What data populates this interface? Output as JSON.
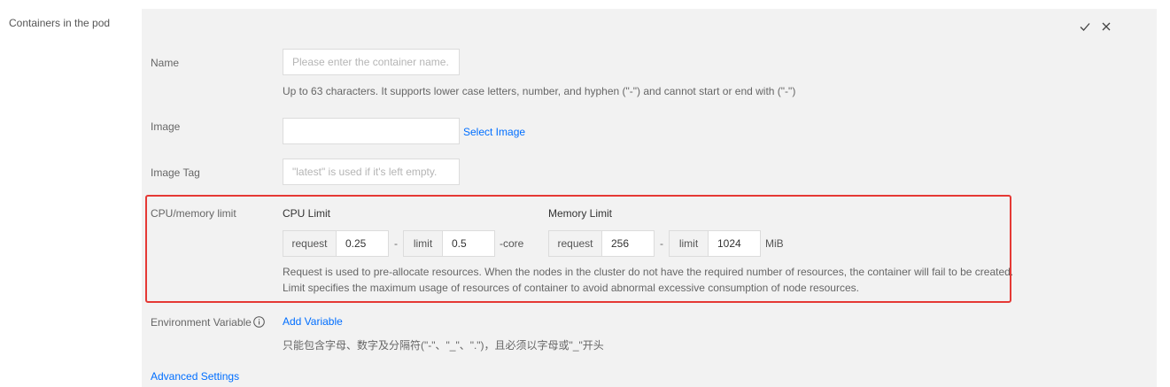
{
  "section": {
    "label": "Containers in the pod"
  },
  "actions": {
    "confirm_icon": "check-icon",
    "close_icon": "close-icon"
  },
  "name": {
    "label": "Name",
    "placeholder": "Please enter the container name.",
    "value": "",
    "hint": "Up to 63 characters. It supports lower case letters, number, and hyphen (\"-\") and cannot start or end with (\"-\")"
  },
  "image": {
    "label": "Image",
    "value": "",
    "select_label": "Select Image"
  },
  "image_tag": {
    "label": "Image Tag",
    "placeholder": "\"latest\" is used if it's left empty.",
    "value": ""
  },
  "resources": {
    "label": "CPU/memory limit",
    "cpu": {
      "title": "CPU Limit",
      "request_label": "request",
      "request_value": "0.25",
      "separator": "-",
      "limit_label": "limit",
      "limit_value": "0.5",
      "unit": "-core"
    },
    "memory": {
      "title": "Memory Limit",
      "request_label": "request",
      "request_value": "256",
      "separator": "-",
      "limit_label": "limit",
      "limit_value": "1024",
      "unit": "MiB"
    },
    "hint_line1": "Request is used to pre-allocate resources. When the nodes in the cluster do not have the required number of resources, the container will fail to be created.",
    "hint_line2": "Limit specifies the maximum usage of resources of container to avoid abnormal excessive consumption of node resources."
  },
  "env": {
    "label": "Environment Variable",
    "info_icon": "info-icon",
    "add_label": "Add Variable",
    "hint": "只能包含字母、数字及分隔符(\"-\"、\"_\"、\".\")，且必须以字母或\"_\"开头"
  },
  "advanced": {
    "label": "Advanced Settings"
  },
  "colors": {
    "link": "#006eff",
    "highlight": "#e53935",
    "panel": "#f2f2f2"
  }
}
